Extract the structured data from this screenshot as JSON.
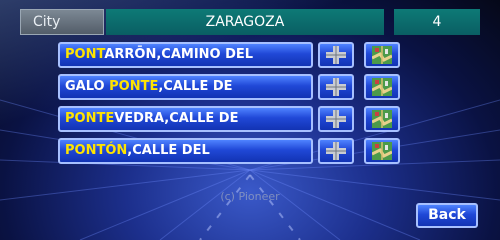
{
  "header": {
    "field_label": "City",
    "field_value": "ZARAGOZA",
    "result_count": "4"
  },
  "results": [
    {
      "match": "PONT",
      "rest": "ARRŌN,CAMINO DEL",
      "prefix": ""
    },
    {
      "match": "PONTE",
      "rest": ",CALLE DE",
      "prefix": "GALO "
    },
    {
      "match": "PONTE",
      "rest": "VEDRA,CALLE DE",
      "prefix": ""
    },
    {
      "match": "PONTÓN",
      "rest": ",CALLE DEL",
      "prefix": ""
    }
  ],
  "icons": {
    "intersection": "intersection-icon",
    "map": "map-icon"
  },
  "colors": {
    "highlight": "#ffe400",
    "button_blue": "#2048d7",
    "teal": "#0d7a76"
  },
  "footer": {
    "copyright": "(c) Pioneer",
    "back_label": "Back"
  }
}
